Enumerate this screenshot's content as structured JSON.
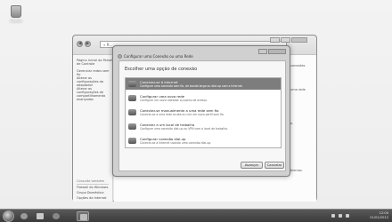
{
  "desktop": {
    "recycle_bin_label": "Lixeira"
  },
  "explorer": {
    "address_text": "« R...",
    "left_pane": {
      "items": [
        "Página Inicial do Painel de Controle",
        "Gerenciar redes sem fio",
        "Alterar as configurações do adaptador",
        "Alterar as configurações de compartilhamento avançadas"
      ],
      "see_also_title": "Consulte também",
      "see_also": [
        "Firewall do Windows",
        "Grupo Doméstico",
        "Opções da Internet"
      ]
    },
    "right_pane": [
      "conexões",
      "uma rede",
      "o.",
      "blemas."
    ]
  },
  "dialog": {
    "title": "Configurar uma Conexão ou uma Rede",
    "heading": "Escolher uma opção de conexão",
    "options": [
      {
        "title": "Conectar-se à Internet",
        "desc": "Configure uma conexão sem fio, de banda larga ou dial-up com a Internet."
      },
      {
        "title": "Configurar uma nova rede",
        "desc": "Configure um novo roteador ou ponto de acesso."
      },
      {
        "title": "Conectar-se manualmente a uma rede sem fio",
        "desc": "Conecte-se a uma rede oculta ou crie um novo perfil sem fio."
      },
      {
        "title": "Conectar a um local de trabalho",
        "desc": "Configure uma conexão dial-up ou VPN com o local de trabalho."
      },
      {
        "title": "Configurar conexão dial-up",
        "desc": "Conecte-se à Internet usando uma conexão dial-up."
      }
    ],
    "selected_index": 0,
    "buttons": {
      "next": "Avançar",
      "cancel": "Cancelar"
    }
  },
  "taskbar": {
    "time": "12:00",
    "date": "01/01/2012"
  }
}
